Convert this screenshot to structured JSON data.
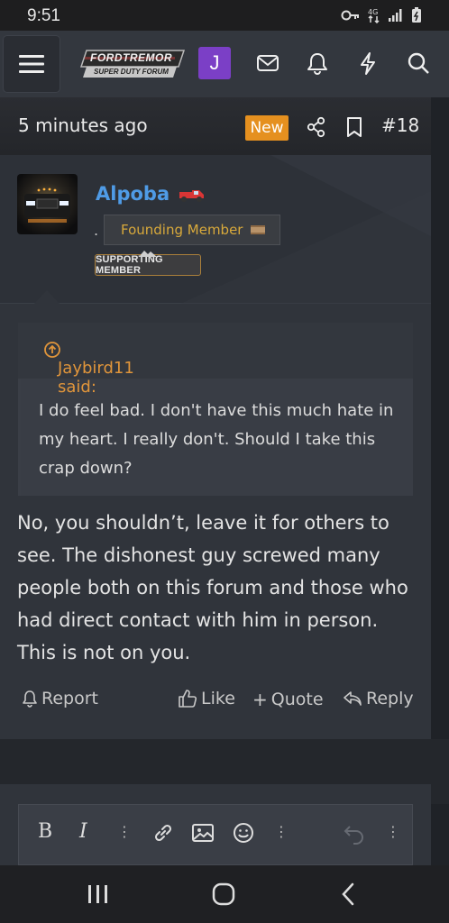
{
  "status_bar": {
    "time": "9:51"
  },
  "nav": {
    "logo_top": "FORDTREMOR",
    "logo_bottom": "SUPER DUTY FORUM",
    "avatar_letter": "J"
  },
  "post": {
    "time": "5 minutes ago",
    "badge": "New",
    "number": "#18",
    "author": {
      "name": "Alpoba",
      "dot": ".",
      "title_badge": "Founding Member",
      "supporting_badge": "SUPPORTING MEMBER"
    },
    "quote": {
      "header": "Jaybird11 said:",
      "body": "I do feel bad. I don't have this much hate in my heart. I really don't. Should I take this crap down?"
    },
    "message": "No, you shouldn’t, leave it for others to see. The dishonest guy screwed many people both on this forum and those who had direct contact with him in person. This is not on you.",
    "actions": {
      "report": "Report",
      "like": "Like",
      "quote": "Quote",
      "reply": "Reply"
    }
  },
  "editor": {
    "bold": "B",
    "italic": "I"
  },
  "colors": {
    "accent_orange": "#e5901f",
    "username_blue": "#4f9be6",
    "avatar_purple": "#7b3fc6",
    "quote_orange": "#e0953b"
  }
}
